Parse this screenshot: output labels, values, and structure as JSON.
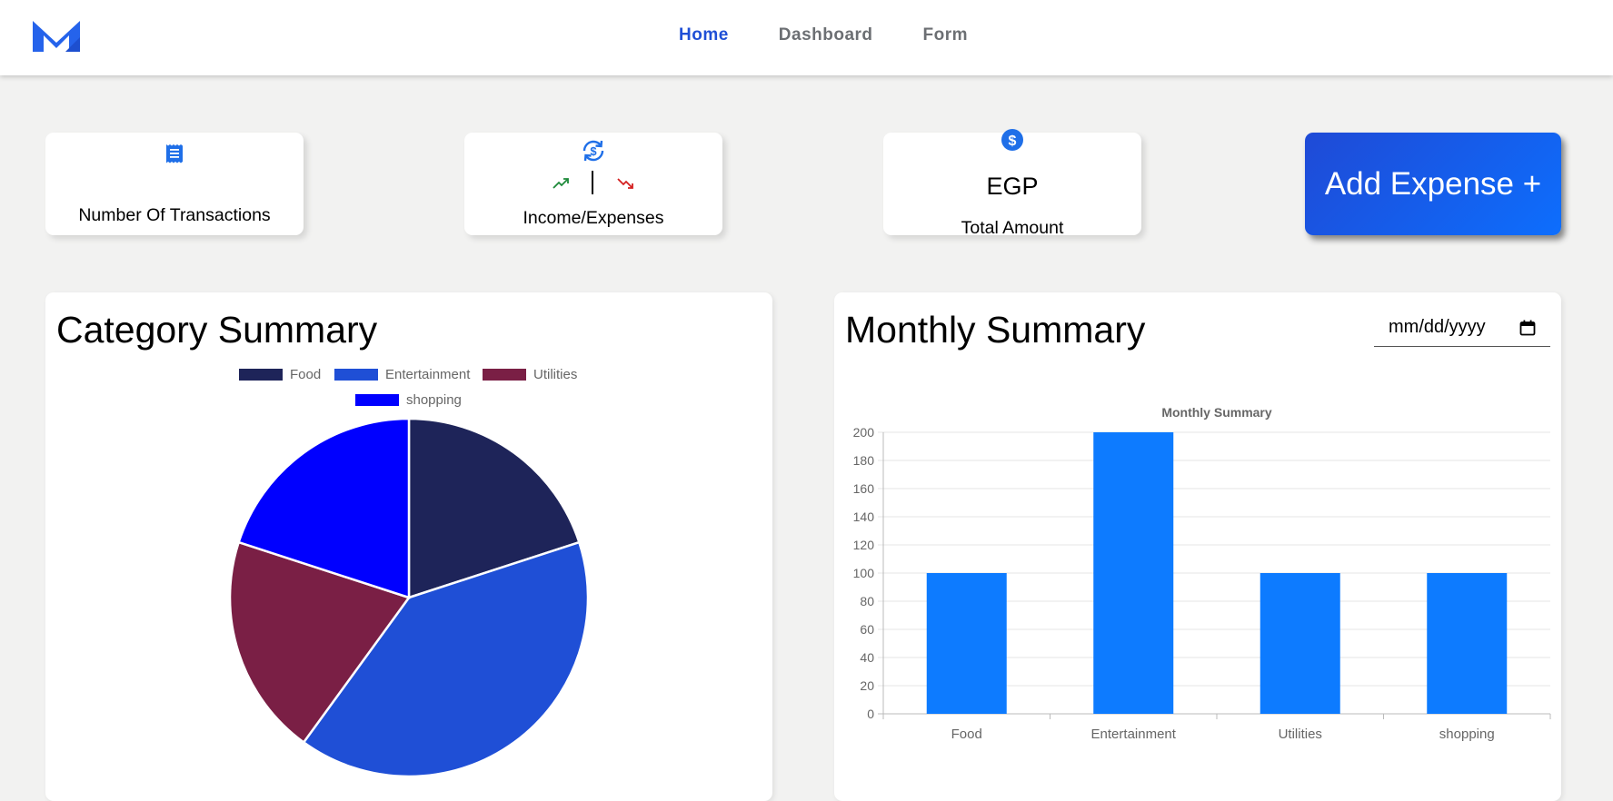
{
  "nav": {
    "logo_icon": "m-logo-icon",
    "links": [
      {
        "label": "Home",
        "active": true
      },
      {
        "label": "Dashboard",
        "active": false
      },
      {
        "label": "Form",
        "active": false
      }
    ]
  },
  "cards": {
    "transactions": {
      "label": "Number Of Transactions",
      "icon": "receipt-icon"
    },
    "income_expenses": {
      "label": "Income/Expenses",
      "icon": "currency-exchange-icon",
      "up_icon": "trend-up-icon",
      "down_icon": "trend-down-icon",
      "separator": "|"
    },
    "total": {
      "label": "Total Amount",
      "currency": "EGP",
      "icon": "dollar-circle-icon"
    }
  },
  "add_expense_label": "Add Expense +",
  "category_summary": {
    "title": "Category Summary",
    "chart_data": {
      "type": "pie",
      "labels": [
        "Food",
        "Entertainment",
        "Utilities",
        "shopping"
      ],
      "values": [
        100,
        200,
        100,
        100
      ],
      "colors": [
        "#1e2459",
        "#1f4fd6",
        "#7a1f45",
        "#0000ff"
      ],
      "legend_position": "top"
    }
  },
  "monthly_summary": {
    "title": "Monthly Summary",
    "date_placeholder": "mm/dd/yyyy",
    "chart_data": {
      "type": "bar",
      "title": "Monthly Summary",
      "categories": [
        "Food",
        "Entertainment",
        "Utilities",
        "shopping"
      ],
      "values": [
        100,
        200,
        100,
        100
      ],
      "ylim": [
        0,
        200
      ],
      "yticks": [
        0,
        20,
        40,
        60,
        80,
        100,
        120,
        140,
        160,
        180,
        200
      ],
      "color": "#0d7bff",
      "grid": true
    }
  },
  "colors": {
    "brand": "#2563eb",
    "nav_active": "#1f4fd6",
    "income": "#1e8a3a",
    "expense": "#d42020"
  }
}
